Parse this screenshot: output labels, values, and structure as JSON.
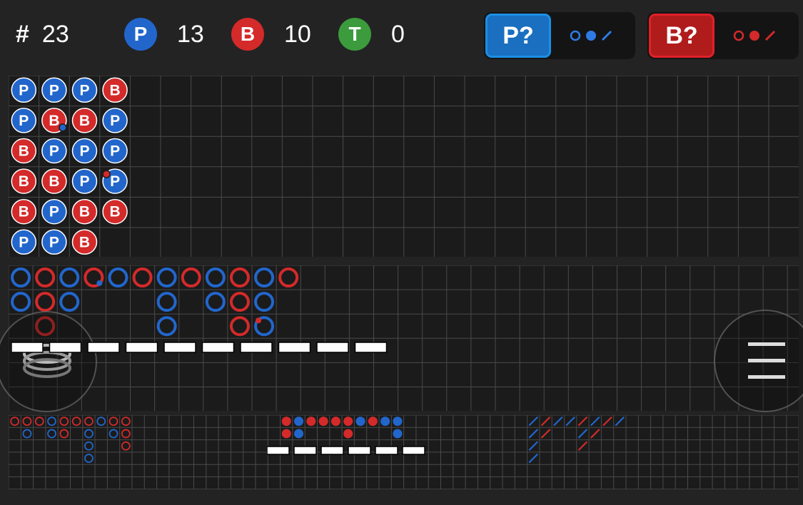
{
  "stats": {
    "round_label": "#",
    "round_count": "23",
    "player_letter": "P",
    "player_count": "13",
    "banker_letter": "B",
    "banker_count": "10",
    "tie_letter": "T",
    "tie_count": "0"
  },
  "predictions": {
    "player_label": "P?",
    "banker_label": "B?"
  },
  "colors": {
    "player": "#2266cc",
    "banker": "#d42a2a",
    "tie": "#3c9b3c",
    "background": "#232323",
    "grid_line": "#4a4a4a",
    "player_highlight": "#1a8fe6",
    "banker_highlight": "#e0202a"
  },
  "big_road_bead": {
    "columns": [
      [
        "P",
        "P",
        "B",
        "B",
        "B",
        "P"
      ],
      [
        "P",
        "B",
        "P",
        "B",
        "P",
        "P"
      ],
      [
        "P",
        "B",
        "P",
        "P",
        "B",
        "B"
      ],
      [
        "B",
        "P",
        "P",
        "P",
        "B"
      ]
    ],
    "marker_cells": [
      {
        "col": 1,
        "row": 1,
        "dot": "P"
      },
      {
        "col": 3,
        "row": 3,
        "dot": "B"
      }
    ]
  },
  "big_road": {
    "columns": [
      [
        "P",
        "P"
      ],
      [
        "B",
        "B",
        "B"
      ],
      [
        "P",
        "P"
      ],
      [
        "B"
      ],
      [
        "P"
      ],
      [
        "B"
      ],
      [
        "P",
        "P",
        "P"
      ],
      [
        "B"
      ],
      [
        "P",
        "P"
      ],
      [
        "B",
        "B",
        "B"
      ],
      [
        "P",
        "P",
        "P"
      ],
      [
        "B"
      ]
    ],
    "marker_cells": [
      {
        "col": 3,
        "row": 0,
        "dot": "P"
      },
      {
        "col": 10,
        "row": 2,
        "dot": "B"
      }
    ]
  },
  "small_boards": {
    "big_eye": {
      "columns": [
        [
          "B"
        ],
        [
          "B",
          "P"
        ],
        [
          "B"
        ],
        [
          "P",
          "P"
        ],
        [
          "B",
          "B"
        ],
        [
          "B"
        ],
        [
          "B",
          "P",
          "P",
          "P"
        ],
        [
          "P"
        ],
        [
          "B",
          "P"
        ],
        [
          "B",
          "B",
          "B"
        ]
      ]
    },
    "small_road": {
      "columns": [
        [
          "B",
          "B"
        ],
        [
          "P",
          "P"
        ],
        [
          "B"
        ],
        [
          "B"
        ],
        [
          "B"
        ],
        [
          "B",
          "B"
        ],
        [
          "P"
        ],
        [
          "B"
        ],
        [
          "P"
        ],
        [
          "P",
          "P"
        ]
      ]
    },
    "cockroach": {
      "columns": [
        [
          "P",
          "P",
          "P",
          "P"
        ],
        [
          "B",
          "B"
        ],
        [
          "P"
        ],
        [
          "P"
        ],
        [
          "B",
          "P",
          "B"
        ],
        [
          "P",
          "B"
        ],
        [
          "B"
        ],
        [
          "P"
        ]
      ]
    }
  },
  "icons": {
    "menu": "hamburger-menu-icon",
    "stack": "stacked-chips-icon"
  }
}
